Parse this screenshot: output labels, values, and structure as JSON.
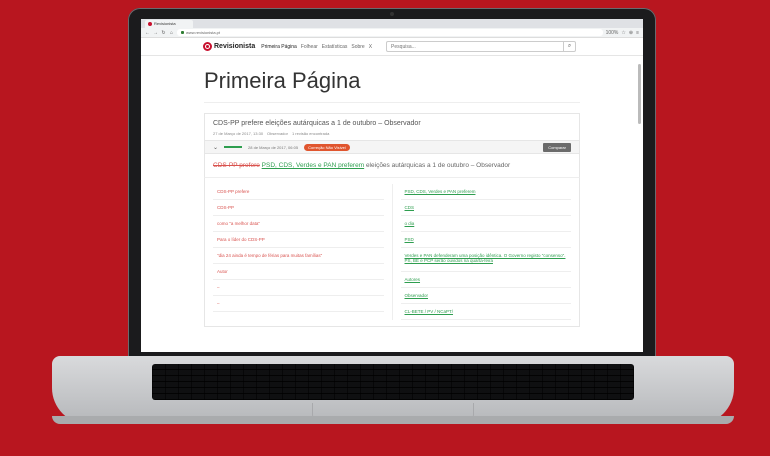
{
  "browser": {
    "tab_title": "Revisionista",
    "url": "www.revisionista.pt",
    "zoom": "100%"
  },
  "site": {
    "logo_text": "Revisionista",
    "nav": [
      "Primeira Página",
      "Folhear",
      "Estatísticas",
      "Sobre"
    ],
    "nav_more": "X",
    "search_placeholder": "Pesquisa..."
  },
  "page": {
    "title": "Primeira Página"
  },
  "article": {
    "title": "CDS-PP prefere eleições autárquicas a 1 de outubro – Observador",
    "meta_date": "27 de Março de 2017, 13:30",
    "meta_source": "Observador",
    "meta_changes": "1 revisão encontrada"
  },
  "version": {
    "date": "28 de Março de 2017, 06:05",
    "badge": "Correção Não Visível",
    "compare_label": "Comparar"
  },
  "diff": {
    "deleted": "CDS-PP prefere",
    "inserted": "PSD, CDS, Verdes e PAN preferem",
    "rest": " eleições autárquicas a 1 de outubro – Observador"
  },
  "removed": [
    "CDS-PP prefere",
    "CDS-PP",
    "como \"a melhor data\"",
    "Para o líder do CDS-PP",
    "\"dia 24 ainda é tempo de férias para muitas famílias\"",
    "Autor",
    "–",
    "–"
  ],
  "added": [
    "PSD, CDS, Verdes e PAN preferem",
    "CDS",
    "o dia",
    "PSD",
    "Verdes e PAN defenderam uma posição idêntica. O Governo registo \"consenso\". PS, BE e PCP serão ouvidos na quarta-feira",
    "Autores",
    "Observador",
    "CL-BETE / PV / NCaPT/"
  ]
}
